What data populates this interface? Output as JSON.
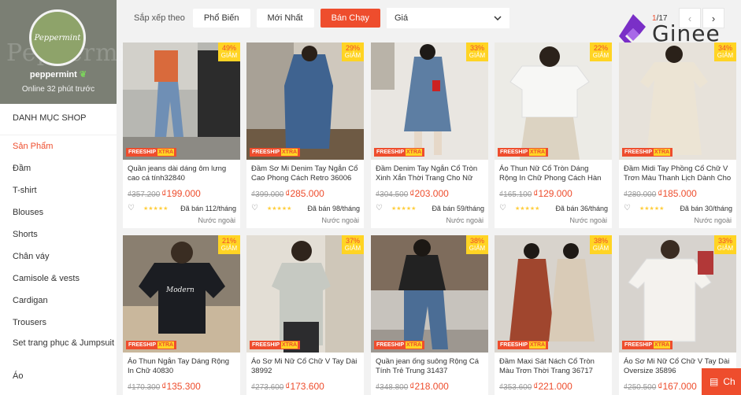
{
  "shop": {
    "logo_text": "Peppermint",
    "bg_text": "Peppermint",
    "name": "peppermint",
    "status": "Online 32 phút trước"
  },
  "categories": {
    "title": "DANH MỤC SHOP",
    "items": [
      "Sản Phẩm",
      "Đầm",
      "T-shirt",
      "Blouses",
      "Shorts",
      "Chân váy",
      "Camisole & vests",
      "Cardigan",
      "Trousers",
      "Set trang phục & Jumpsuit",
      "Áo"
    ]
  },
  "sortbar": {
    "label": "Sắp xếp theo",
    "options": [
      "Phổ Biến",
      "Mới Nhất",
      "Bán Chạy"
    ],
    "price_label": "Giá",
    "page_current": "1",
    "page_total": "/17",
    "prev": "‹",
    "next": "›"
  },
  "brand": {
    "name": "Ginee"
  },
  "labels": {
    "freeship": "FREESHIP",
    "freeship_tag": "XTRA",
    "discount_word": "GIẢM",
    "origin": "Nước ngoài",
    "chat": "Ch"
  },
  "colors": {
    "accent": "#ee4d2d",
    "badge": "#ffd424"
  },
  "products": [
    {
      "discount": "49%",
      "name": "Quần jeans dài dáng ôm lưng cao cá tính32840",
      "old_price": "₫357.200",
      "price": "₫199.000",
      "sold": "Đã bán 112/tháng"
    },
    {
      "discount": "29%",
      "name": "Đầm Sơ Mi Denim Tay Ngắn Cổ Cao Phong Cách Retro 36006",
      "old_price": "₫399.000",
      "price": "₫285.000",
      "sold": "Đã bán 98/tháng"
    },
    {
      "discount": "33%",
      "name": "Đầm Denim Tay Ngắn Cổ Tròn Xinh Xắn Thời Trang Cho Nữ",
      "old_price": "₫304.500",
      "price": "₫203.000",
      "sold": "Đã bán 59/tháng"
    },
    {
      "discount": "22%",
      "name": "Áo Thun Nữ Cổ Tròn Dáng Rộng In Chữ Phong Cách Hàn Quốc",
      "old_price": "₫165.100",
      "price": "₫129.000",
      "sold": "Đã bán 36/tháng"
    },
    {
      "discount": "34%",
      "name": "Đầm Midi Tay Phồng Cổ Chữ V Trơn Màu Thanh Lịch Dành Cho",
      "old_price": "₫280.000",
      "price": "₫185.000",
      "sold": "Đã bán 30/tháng"
    },
    {
      "discount": "21%",
      "name": "Áo Thun Ngắn Tay Dáng Rộng In Chữ 40830",
      "old_price": "₫170.300",
      "price": "₫135.300",
      "sold": ""
    },
    {
      "discount": "37%",
      "name": "Áo Sơ Mi Nữ Cổ Chữ V Tay Dài 38992",
      "old_price": "₫273.600",
      "price": "₫173.600",
      "sold": ""
    },
    {
      "discount": "38%",
      "name": "Quần jean ống suông Rộng Cá Tính Trẻ Trung 31437",
      "old_price": "₫348.800",
      "price": "₫218.000",
      "sold": ""
    },
    {
      "discount": "38%",
      "name": "Đầm Maxi Sát Nách Cổ Tròn Màu Trơn Thời Trang 36717",
      "old_price": "₫353.600",
      "price": "₫221.000",
      "sold": ""
    },
    {
      "discount": "33%",
      "name": "Áo Sơ Mi Nữ Cổ Chữ V Tay Dài Oversize 35896",
      "old_price": "₫250.500",
      "price": "₫167.000",
      "sold": ""
    }
  ]
}
